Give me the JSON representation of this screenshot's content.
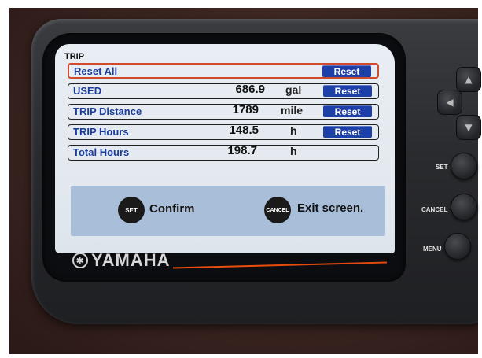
{
  "screen": {
    "title": "TRIP",
    "rows": [
      {
        "label": "Reset All",
        "value": "",
        "unit": "",
        "button": "Reset",
        "selected": true
      },
      {
        "label": "USED",
        "value": "686.9",
        "unit": "gal",
        "button": "Reset",
        "selected": false
      },
      {
        "label": "TRIP Distance",
        "value": "1789",
        "unit": "mile",
        "button": "Reset",
        "selected": false
      },
      {
        "label": "TRIP Hours",
        "value": "148.5",
        "unit": "h",
        "button": "Reset",
        "selected": false
      },
      {
        "label": "Total Hours",
        "value": "198.7",
        "unit": "h",
        "button": "",
        "selected": false
      }
    ],
    "footer": {
      "set_key": "SET",
      "set_label": "Confirm",
      "cancel_key": "CANCEL",
      "cancel_label": "Exit screen."
    }
  },
  "brand": {
    "name": "YAMAHA",
    "accent_color": "#f0500e"
  },
  "hardware": {
    "set_label": "SET",
    "cancel_label": "CANCEL",
    "menu_label": "MENU"
  }
}
